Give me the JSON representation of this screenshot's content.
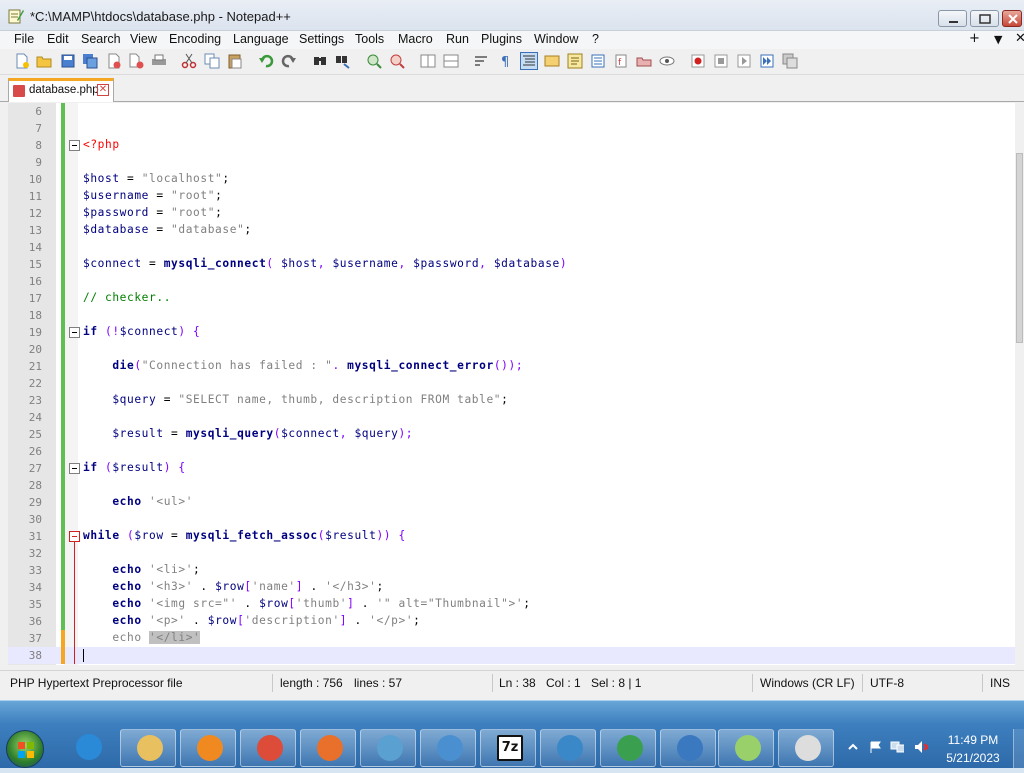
{
  "window": {
    "title": "*C:\\MAMP\\htdocs\\database.php - Notepad++"
  },
  "menubar": {
    "items": [
      "File",
      "Edit",
      "Search",
      "View",
      "Encoding",
      "Language",
      "Settings",
      "Tools",
      "Macro",
      "Run",
      "Plugins",
      "Window",
      "?"
    ],
    "right_controls": [
      "+",
      "▼",
      "✕"
    ]
  },
  "toolbar": {
    "icons": [
      "new-file-icon",
      "open-file-icon",
      "save-icon",
      "save-all-icon",
      "close-icon",
      "close-all-icon",
      "print-icon",
      "cut-icon",
      "copy-icon",
      "paste-icon",
      "undo-icon",
      "redo-icon",
      "find-icon",
      "replace-icon",
      "zoom-in-icon",
      "zoom-out-icon",
      "sync-vertical-icon",
      "sync-horizontal-icon",
      "word-wrap-icon",
      "show-all-chars-icon",
      "indent-guide-icon",
      "user-defined-lang-icon",
      "doc-map-icon",
      "function-list-icon",
      "folder-workspace-icon",
      "monitoring-icon",
      "record-macro-icon",
      "stop-record-icon",
      "playback-icon",
      "run-macro-multiple-icon",
      "save-macro-icon"
    ]
  },
  "tab": {
    "label": "database.php",
    "close": "✕"
  },
  "editor": {
    "lines": [
      {
        "n": "6",
        "code": [
          {
            "t": "pl",
            "s": ""
          }
        ]
      },
      {
        "n": "7",
        "code": [
          {
            "t": "pl",
            "s": ""
          }
        ]
      },
      {
        "n": "8",
        "code": [
          {
            "t": "php",
            "s": "<?php"
          }
        ]
      },
      {
        "n": "9",
        "code": [
          {
            "t": "pl",
            "s": ""
          }
        ]
      },
      {
        "n": "10",
        "code": [
          {
            "t": "var",
            "s": "$host"
          },
          {
            "t": "pl",
            "s": " = "
          },
          {
            "t": "str",
            "s": "\"localhost\""
          },
          {
            "t": "pl",
            "s": ";"
          }
        ]
      },
      {
        "n": "11",
        "code": [
          {
            "t": "var",
            "s": "$username"
          },
          {
            "t": "pl",
            "s": " = "
          },
          {
            "t": "str",
            "s": "\"root\""
          },
          {
            "t": "pl",
            "s": ";"
          }
        ]
      },
      {
        "n": "12",
        "code": [
          {
            "t": "var",
            "s": "$password"
          },
          {
            "t": "pl",
            "s": " = "
          },
          {
            "t": "str",
            "s": "\"root\""
          },
          {
            "t": "pl",
            "s": ";"
          }
        ]
      },
      {
        "n": "13",
        "code": [
          {
            "t": "var",
            "s": "$database"
          },
          {
            "t": "pl",
            "s": " = "
          },
          {
            "t": "str",
            "s": "\"database\""
          },
          {
            "t": "pl",
            "s": ";"
          }
        ]
      },
      {
        "n": "14",
        "code": [
          {
            "t": "pl",
            "s": ""
          }
        ]
      },
      {
        "n": "15",
        "code": [
          {
            "t": "var",
            "s": "$connect"
          },
          {
            "t": "pl",
            "s": " = "
          },
          {
            "t": "fn",
            "s": "mysqli_connect"
          },
          {
            "t": "op",
            "s": "( "
          },
          {
            "t": "var",
            "s": "$host"
          },
          {
            "t": "op",
            "s": ", "
          },
          {
            "t": "var",
            "s": "$username"
          },
          {
            "t": "op",
            "s": ", "
          },
          {
            "t": "var",
            "s": "$password"
          },
          {
            "t": "op",
            "s": ", "
          },
          {
            "t": "var",
            "s": "$database"
          },
          {
            "t": "op",
            "s": ")"
          }
        ]
      },
      {
        "n": "16",
        "code": [
          {
            "t": "pl",
            "s": ""
          }
        ]
      },
      {
        "n": "17",
        "code": [
          {
            "t": "cmt",
            "s": "// checker.."
          }
        ]
      },
      {
        "n": "18",
        "code": [
          {
            "t": "pl",
            "s": ""
          }
        ]
      },
      {
        "n": "19",
        "code": [
          {
            "t": "kw",
            "s": "if"
          },
          {
            "t": "op",
            "s": " (!"
          },
          {
            "t": "var",
            "s": "$connect"
          },
          {
            "t": "op",
            "s": ") {"
          }
        ]
      },
      {
        "n": "20",
        "code": [
          {
            "t": "pl",
            "s": ""
          }
        ]
      },
      {
        "n": "21",
        "code": [
          {
            "t": "pl",
            "s": "    "
          },
          {
            "t": "fn",
            "s": "die"
          },
          {
            "t": "op",
            "s": "("
          },
          {
            "t": "str",
            "s": "\"Connection has failed : \""
          },
          {
            "t": "op",
            "s": ". "
          },
          {
            "t": "fn",
            "s": "mysqli_connect_error"
          },
          {
            "t": "op",
            "s": "());"
          }
        ]
      },
      {
        "n": "22",
        "code": [
          {
            "t": "pl",
            "s": ""
          }
        ]
      },
      {
        "n": "23",
        "code": [
          {
            "t": "pl",
            "s": "    "
          },
          {
            "t": "var",
            "s": "$query"
          },
          {
            "t": "pl",
            "s": " = "
          },
          {
            "t": "str",
            "s": "\"SELECT name, thumb, description FROM table\""
          },
          {
            "t": "pl",
            "s": ";"
          }
        ]
      },
      {
        "n": "24",
        "code": [
          {
            "t": "pl",
            "s": ""
          }
        ]
      },
      {
        "n": "25",
        "code": [
          {
            "t": "pl",
            "s": "    "
          },
          {
            "t": "var",
            "s": "$result"
          },
          {
            "t": "pl",
            "s": " = "
          },
          {
            "t": "fn",
            "s": "mysqli_query"
          },
          {
            "t": "op",
            "s": "("
          },
          {
            "t": "var",
            "s": "$connect"
          },
          {
            "t": "op",
            "s": ", "
          },
          {
            "t": "var",
            "s": "$query"
          },
          {
            "t": "op",
            "s": ");"
          }
        ]
      },
      {
        "n": "26",
        "code": [
          {
            "t": "pl",
            "s": ""
          }
        ]
      },
      {
        "n": "27",
        "code": [
          {
            "t": "kw",
            "s": "if"
          },
          {
            "t": "op",
            "s": " ("
          },
          {
            "t": "var",
            "s": "$result"
          },
          {
            "t": "op",
            "s": ") {"
          }
        ]
      },
      {
        "n": "28",
        "code": [
          {
            "t": "pl",
            "s": ""
          }
        ]
      },
      {
        "n": "29",
        "code": [
          {
            "t": "pl",
            "s": "    "
          },
          {
            "t": "kw",
            "s": "echo"
          },
          {
            "t": "pl",
            "s": " "
          },
          {
            "t": "str",
            "s": "'<ul>'"
          }
        ]
      },
      {
        "n": "30",
        "code": [
          {
            "t": "pl",
            "s": ""
          }
        ]
      },
      {
        "n": "31",
        "code": [
          {
            "t": "kw",
            "s": "while"
          },
          {
            "t": "op",
            "s": " ("
          },
          {
            "t": "var",
            "s": "$row"
          },
          {
            "t": "pl",
            "s": " = "
          },
          {
            "t": "fn",
            "s": "mysqli_fetch_assoc"
          },
          {
            "t": "op",
            "s": "("
          },
          {
            "t": "var",
            "s": "$result"
          },
          {
            "t": "op",
            "s": ")) {"
          }
        ]
      },
      {
        "n": "32",
        "code": [
          {
            "t": "pl",
            "s": ""
          }
        ]
      },
      {
        "n": "33",
        "code": [
          {
            "t": "pl",
            "s": "    "
          },
          {
            "t": "kw",
            "s": "echo"
          },
          {
            "t": "pl",
            "s": " "
          },
          {
            "t": "str",
            "s": "'<li>'"
          },
          {
            "t": "pl",
            "s": ";"
          }
        ]
      },
      {
        "n": "34",
        "code": [
          {
            "t": "pl",
            "s": "    "
          },
          {
            "t": "kw",
            "s": "echo"
          },
          {
            "t": "pl",
            "s": " "
          },
          {
            "t": "str",
            "s": "'<h3>'"
          },
          {
            "t": "pl",
            "s": " . "
          },
          {
            "t": "var",
            "s": "$row"
          },
          {
            "t": "op",
            "s": "["
          },
          {
            "t": "str",
            "s": "'name'"
          },
          {
            "t": "op",
            "s": "]"
          },
          {
            "t": "pl",
            "s": " . "
          },
          {
            "t": "str",
            "s": "'</h3>'"
          },
          {
            "t": "pl",
            "s": ";"
          }
        ]
      },
      {
        "n": "35",
        "code": [
          {
            "t": "pl",
            "s": "    "
          },
          {
            "t": "kw",
            "s": "echo"
          },
          {
            "t": "pl",
            "s": " "
          },
          {
            "t": "str",
            "s": "'<img src=\"'"
          },
          {
            "t": "pl",
            "s": " . "
          },
          {
            "t": "var",
            "s": "$row"
          },
          {
            "t": "op",
            "s": "["
          },
          {
            "t": "str",
            "s": "'thumb'"
          },
          {
            "t": "op",
            "s": "]"
          },
          {
            "t": "pl",
            "s": " . "
          },
          {
            "t": "str",
            "s": "'\" alt=\"Thumbnail\">'"
          },
          {
            "t": "pl",
            "s": ";"
          }
        ]
      },
      {
        "n": "36",
        "code": [
          {
            "t": "pl",
            "s": "    "
          },
          {
            "t": "kw",
            "s": "echo"
          },
          {
            "t": "pl",
            "s": " "
          },
          {
            "t": "str",
            "s": "'<p>'"
          },
          {
            "t": "pl",
            "s": " . "
          },
          {
            "t": "var",
            "s": "$row"
          },
          {
            "t": "op",
            "s": "["
          },
          {
            "t": "str",
            "s": "'description'"
          },
          {
            "t": "op",
            "s": "]"
          },
          {
            "t": "pl",
            "s": " . "
          },
          {
            "t": "str",
            "s": "'</p>'"
          },
          {
            "t": "pl",
            "s": ";"
          }
        ]
      },
      {
        "n": "37",
        "code": [
          {
            "t": "pl",
            "s": "    "
          },
          {
            "t": "str",
            "s": "echo"
          },
          {
            "t": "pl",
            "s": " "
          },
          {
            "t": "sel",
            "s": "'</li>'"
          }
        ]
      },
      {
        "n": "38",
        "code": [
          {
            "t": "pl",
            "s": ""
          }
        ]
      }
    ],
    "current_line": "38",
    "fold_open": [
      "8",
      "19",
      "27"
    ],
    "fold_red": [
      "31"
    ]
  },
  "statusbar": {
    "language": "PHP Hypertext Preprocessor file",
    "length": "length : 756",
    "lines": "lines : 57",
    "ln": "Ln : 38",
    "col": "Col : 1",
    "sel": "Sel : 8 | 1",
    "eol": "Windows (CR LF)",
    "encoding": "UTF-8",
    "mode": "INS"
  },
  "taskbar": {
    "apps": [
      "internet-explorer-icon",
      "file-explorer-icon",
      "media-player-icon",
      "chrome-icon",
      "firefox-icon",
      "mysql-dolphin-icon",
      "network-settings-icon",
      "7zip-icon",
      "mysql-workbench-icon",
      "globe-update-icon",
      "dropbox-icon",
      "notepadpp-icon",
      "lambda-app-icon"
    ],
    "seven_zip_label": "7z",
    "clock_time": "11:49 PM",
    "clock_date": "5/21/2023"
  }
}
